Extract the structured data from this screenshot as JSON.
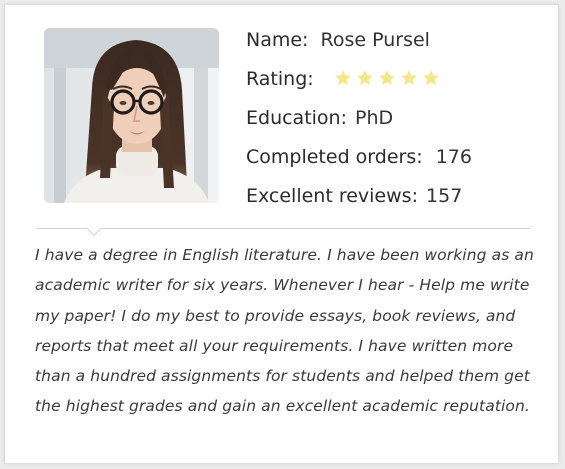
{
  "profile": {
    "name_label": "Name:",
    "name_value": "Rose Pursel",
    "rating_label": "Rating:",
    "rating_stars": 5,
    "star_color": "#f3e78b",
    "education_label": "Education:",
    "education_value": "PhD",
    "orders_label": "Completed orders:",
    "orders_value": "176",
    "reviews_label": "Excellent reviews:",
    "reviews_value": "157",
    "photo_icon": "writer-portrait-photo"
  },
  "bio": {
    "lines": [
      " I have a degree in English literature. I have been working as an",
      "academic writer for six years. Whenever I hear - Help me write",
      "my paper! I do my best to provide essays, book reviews, and",
      "reports that meet all your requirements. I have written more",
      "than a hundred assignments for students and helped them get",
      "the highest grades and gain an excellent academic reputation."
    ]
  }
}
